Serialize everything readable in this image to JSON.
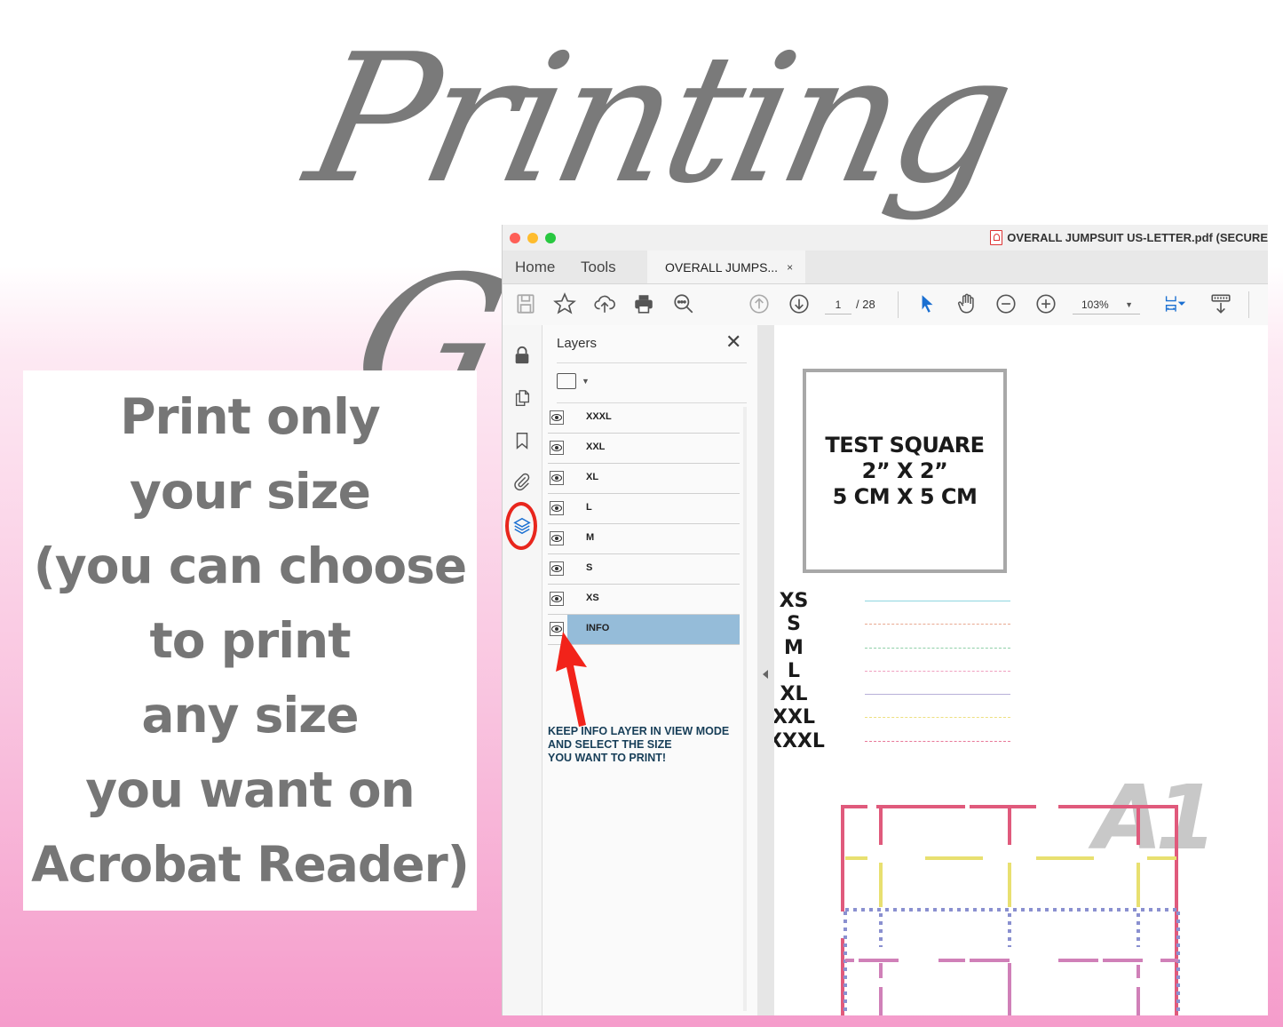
{
  "header": {
    "title": "Printing Guide"
  },
  "note": {
    "lines": [
      "Print only",
      "your size",
      "(you can choose",
      "to print",
      "any size",
      "you want on",
      "Acrobat Reader)"
    ]
  },
  "window": {
    "title": "OVERALL JUMPSUIT US-LETTER.pdf (SECURE",
    "traffic_lights": {
      "close": "#fe5f57",
      "minimize": "#febc2e",
      "zoom": "#28c840"
    },
    "tabs": {
      "home": "Home",
      "tools": "Tools",
      "document": "OVERALL JUMPS...",
      "close_glyph": "×"
    },
    "toolbar": {
      "icons": [
        "save-icon",
        "star-icon",
        "cloud-upload-icon",
        "print-icon",
        "search-zoom-icon",
        "page-up-icon",
        "page-down-icon",
        "select-cursor-icon",
        "hand-icon",
        "zoom-out-icon",
        "zoom-in-icon",
        "fit-page-icon",
        "measure-icon"
      ],
      "current_page": "1",
      "total_pages": "/ 28",
      "zoom_level": "103%"
    },
    "left_rail": {
      "icons": [
        "lock-icon",
        "pages-icon",
        "bookmark-icon",
        "attachment-icon",
        "layers-icon"
      ],
      "active": "layers-icon",
      "highlight_color": "#e8261d"
    },
    "layers_panel": {
      "title": "Layers",
      "close_glyph": "✕",
      "layers": [
        {
          "name": "XXXL",
          "visible": true,
          "selected": false
        },
        {
          "name": "XXL",
          "visible": true,
          "selected": false
        },
        {
          "name": "XL",
          "visible": true,
          "selected": false
        },
        {
          "name": "L",
          "visible": true,
          "selected": false
        },
        {
          "name": "M",
          "visible": true,
          "selected": false
        },
        {
          "name": "S",
          "visible": true,
          "selected": false
        },
        {
          "name": "XS",
          "visible": true,
          "selected": false
        },
        {
          "name": "INFO",
          "visible": true,
          "selected": true
        }
      ],
      "callout": [
        "KEEP INFO LAYER IN VIEW MODE",
        "AND SELECT THE SIZE",
        "YOU WANT TO PRINT!"
      ]
    },
    "document": {
      "test_square": [
        "TEST SQUARE",
        "2” X 2”",
        "5 CM X 5 CM"
      ],
      "size_legend": [
        {
          "size": "XS",
          "color": "#8fd6e0",
          "style": "solid"
        },
        {
          "size": "S",
          "color": "#e8a890",
          "style": "dash-dot"
        },
        {
          "size": "M",
          "color": "#8fcfa8",
          "style": "dashed"
        },
        {
          "size": "L",
          "color": "#f0a0c0",
          "style": "long-dash"
        },
        {
          "size": "XL",
          "color": "#b8b0d8",
          "style": "solid"
        },
        {
          "size": "XXL",
          "color": "#eee080",
          "style": "dashed"
        },
        {
          "size": "XXXL",
          "color": "#e87898",
          "style": "long-dash"
        }
      ],
      "piece_label": "A1"
    }
  }
}
